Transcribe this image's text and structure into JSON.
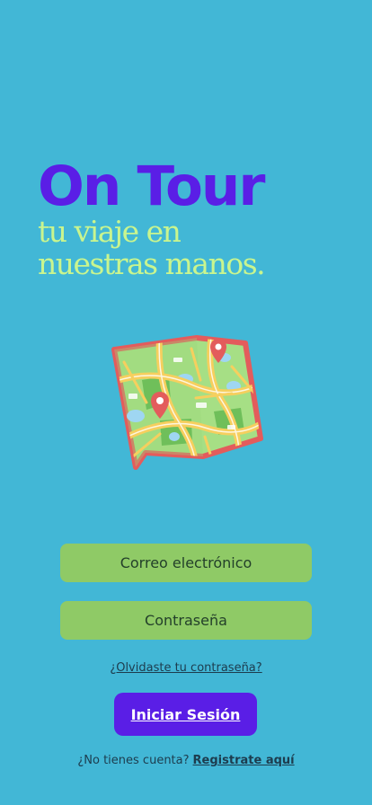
{
  "app": {
    "title": "On Tour",
    "subtitle_line1": "tu viaje en",
    "subtitle_line2": "nuestras manos."
  },
  "illustration": {
    "icon": "map-icon",
    "colors": {
      "border": "#e35c5c",
      "land": "#a6df85",
      "road": "#f6cf5e",
      "water": "#9fd6f2",
      "pin": "#e35c5c"
    }
  },
  "form": {
    "email_placeholder": "Correo electrónico",
    "password_placeholder": "Contraseña",
    "forgot_link": "¿Olvidaste tu contraseña?",
    "login_button": "Iniciar Sesión"
  },
  "signup": {
    "prompt": "¿No tienes cuenta?",
    "link": "Registrate aquí"
  },
  "colors": {
    "background": "#42b7d6",
    "title": "#5a1ee6",
    "subtitle": "#c9f58e",
    "field": "#8fca66",
    "button": "#5a1ee6"
  }
}
